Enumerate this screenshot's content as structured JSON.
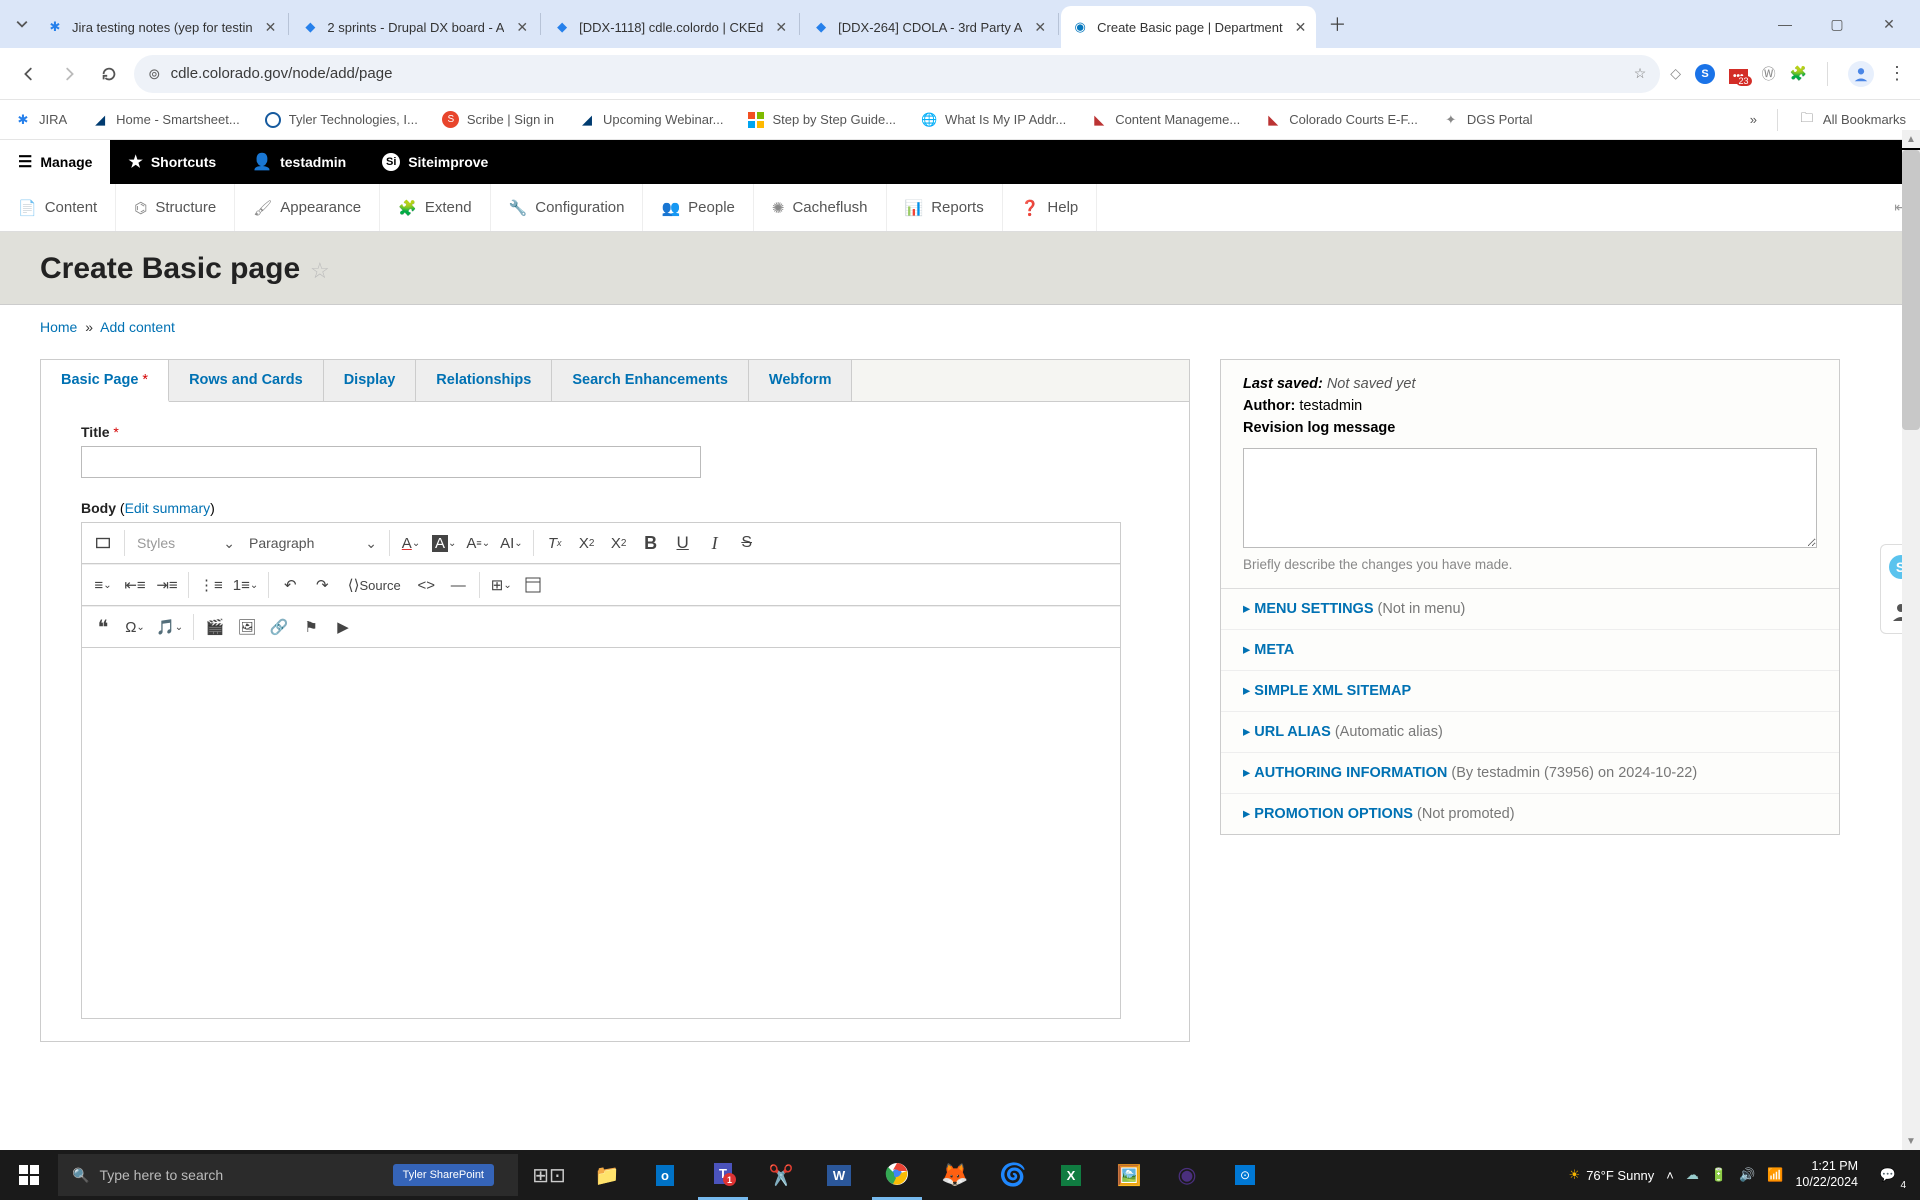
{
  "browser": {
    "tabs": [
      {
        "title": "Jira testing notes (yep for testin"
      },
      {
        "title": "2 sprints - Drupal DX board - A"
      },
      {
        "title": "[DDX-1118] cdle.colordo | CKEd"
      },
      {
        "title": "[DDX-264] CDOLA - 3rd Party A"
      },
      {
        "title": "Create Basic page | Department"
      }
    ],
    "url": "cdle.colorado.gov/node/add/page",
    "badge": "23",
    "all_bookmarks": "All Bookmarks"
  },
  "bookmarks": [
    "JIRA",
    "Home - Smartsheet...",
    "Tyler Technologies, I...",
    "Scribe | Sign in",
    "Upcoming Webinar...",
    "Step by Step Guide...",
    "What Is My IP Addr...",
    "Content Manageme...",
    "Colorado Courts E-F...",
    "DGS Portal"
  ],
  "drupal_toolbar": {
    "manage": "Manage",
    "shortcuts": "Shortcuts",
    "user": "testadmin",
    "siteimprove": "Siteimprove"
  },
  "drupal_menu": [
    "Content",
    "Structure",
    "Appearance",
    "Extend",
    "Configuration",
    "People",
    "Cacheflush",
    "Reports",
    "Help"
  ],
  "page": {
    "title": "Create Basic page",
    "breadcrumb_home": "Home",
    "breadcrumb_add": "Add content"
  },
  "form_tabs": [
    "Basic Page",
    "Rows and Cards",
    "Display",
    "Relationships",
    "Search Enhancements",
    "Webform"
  ],
  "form": {
    "title_label": "Title",
    "body_label": "Body",
    "edit_summary": "Edit summary",
    "styles_placeholder": "Styles",
    "format_placeholder": "Paragraph",
    "source_label": "Source"
  },
  "sidebar": {
    "last_saved_label": "Last saved:",
    "last_saved_value": "Not saved yet",
    "author_label": "Author:",
    "author_value": "testadmin",
    "revlog_label": "Revision log message",
    "revlog_hint": "Briefly describe the changes you have made.",
    "details": [
      {
        "title": "MENU SETTINGS",
        "hint": "(Not in menu)"
      },
      {
        "title": "META",
        "hint": ""
      },
      {
        "title": "SIMPLE XML SITEMAP",
        "hint": ""
      },
      {
        "title": "URL ALIAS",
        "hint": "(Automatic alias)"
      },
      {
        "title": "AUTHORING INFORMATION",
        "hint": "(By testadmin (73956) on 2024-10-22)"
      },
      {
        "title": "PROMOTION OPTIONS",
        "hint": "(Not promoted)"
      }
    ]
  },
  "taskbar": {
    "search_placeholder": "Type here to search",
    "tyler": "Tyler SharePoint",
    "weather": "76°F  Sunny",
    "time": "1:21 PM",
    "date": "10/22/2024",
    "notif_count": "4"
  }
}
